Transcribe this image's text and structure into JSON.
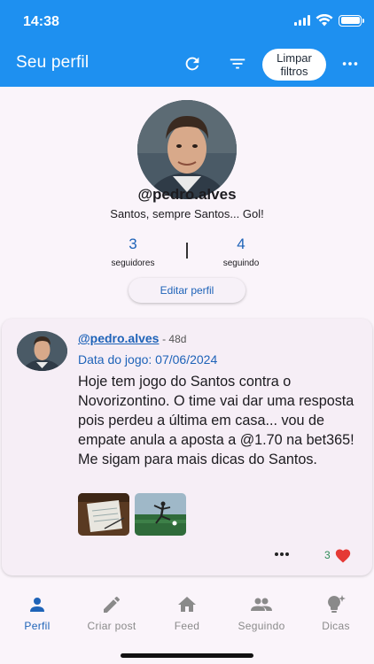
{
  "status_bar": {
    "time": "14:38"
  },
  "app_bar": {
    "title": "Seu perfil",
    "clear_filters_label": "Limpar filtros",
    "icons": [
      "refresh-icon",
      "filter-icon",
      "more-vert-icon"
    ]
  },
  "profile": {
    "handle": "@pedro.alves",
    "bio": "Santos, sempre Santos... Gol!",
    "followers_count": "3",
    "followers_label": "seguidores",
    "following_count": "4",
    "following_label": "seguindo",
    "edit_button": "Editar perfil"
  },
  "post": {
    "user": "@pedro.alves",
    "age": "- 48d",
    "game_date": "Data do jogo: 07/06/2024",
    "text": "Hoje tem jogo do Santos contra o Novorizontino. O time vai dar uma resposta pois perdeu a última em casa... vou de empate anula a aposta a @1.70 na bet365! Me sigam para mais dicas do Santos.",
    "likes": "3"
  },
  "bottom_nav": {
    "items": [
      {
        "label": "Perfil",
        "icon": "person-icon",
        "active": true
      },
      {
        "label": "Criar post",
        "icon": "pencil-icon",
        "active": false
      },
      {
        "label": "Feed",
        "icon": "home-icon",
        "active": false
      },
      {
        "label": "Seguindo",
        "icon": "people-icon",
        "active": false
      },
      {
        "label": "Dicas",
        "icon": "lightbulb-icon",
        "active": false
      }
    ]
  },
  "colors": {
    "primary": "#1e90f0",
    "accent_text": "#1e63b8",
    "heart": "#e53935"
  }
}
